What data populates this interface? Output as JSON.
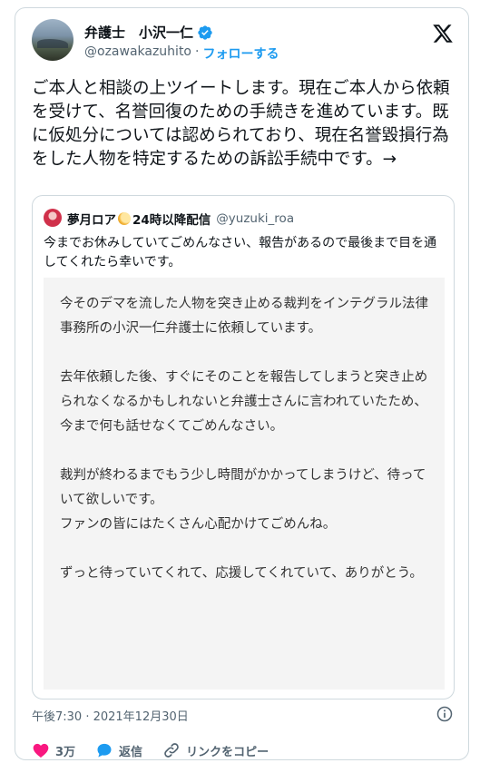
{
  "author": {
    "name": "弁護士　小沢一仁",
    "handle": "@ozawakazuhito",
    "separator": "·",
    "follow_label": "フォローする"
  },
  "tweet": {
    "text": "ご本人と相談の上ツイートします。現在ご本人から依頼を受けて、名誉回復のための手続きを進めています。既に仮処分については認められており、現在名誉毀損行為をした人物を特定するための訴訟手続中です。→"
  },
  "quote": {
    "name": "夢月ロア",
    "name_suffix": "24時以降配信",
    "handle": "@yuzuki_roa",
    "text": "今までお休みしていてごめんなさい、報告があるので最後まで目を通してくれたら幸いです。",
    "image_text": "今そのデマを流した人物を突き止める裁判をインテグラル法律事務所の小沢一仁弁護士に依頼しています。\n\n去年依頼した後、すぐにそのことを報告してしまうと突き止められなくなるかもしれないと弁護士さんに言われていたため、今まで何も話せなくてごめんなさい。\n\n裁判が終わるまでもう少し時間がかかってしまうけど、待っていて欲しいです。\nファンの皆にはたくさん心配かけてごめんね。\n\nずっと待っていてくれて、応援してくれていて、ありがとう。"
  },
  "meta": {
    "timestamp": "午後7:30 · 2021年12月30日"
  },
  "actions": {
    "like_count": "3万",
    "reply_label": "返信",
    "copy_link_label": "リンクをコピー"
  },
  "colors": {
    "accent": "#1d9bf0",
    "like": "#f91880",
    "muted": "#536471"
  }
}
